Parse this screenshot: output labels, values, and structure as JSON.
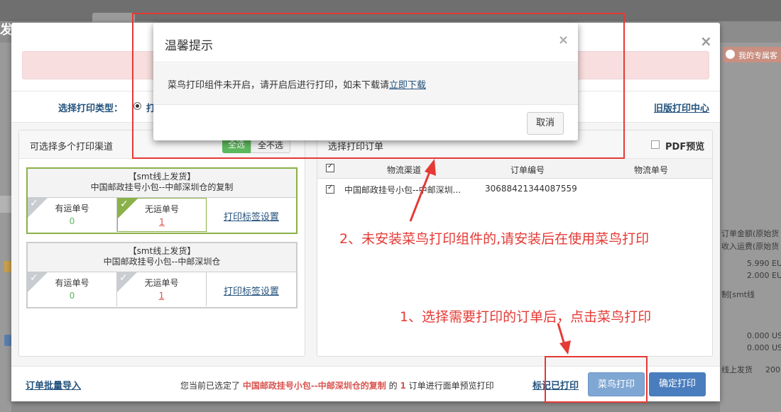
{
  "background": {
    "left_text": "发",
    "service_label": "我的专属客",
    "right_texts": [
      "订单金额(原始货",
      "收入运费(原始货",
      "5.990 EU",
      "2.000 EU",
      "制[smt线",
      "0.000 US",
      "0.000 US",
      "线上发货",
      "200"
    ]
  },
  "dialog": {
    "print_type_label": "选择打印类型：",
    "print_type_option": "打",
    "old_print_center": "旧版打印中心",
    "left_panel": {
      "title": "可选择多个打印渠道",
      "select_all": "全选",
      "select_none": "全不选",
      "cards": [
        {
          "title_line1": "【smt线上发货】",
          "title_line2": "中国邮政挂号小包--中邮深圳仓的复制",
          "with_tracking_label": "有运单号",
          "with_tracking_count": "0",
          "without_tracking_label": "无运单号",
          "without_tracking_count": "1",
          "label_settings": "打印标签设置"
        },
        {
          "title_line1": "【smt线上发货】",
          "title_line2": "中国邮政挂号小包--中邮深圳仓",
          "with_tracking_label": "有运单号",
          "with_tracking_count": "0",
          "without_tracking_label": "无运单号",
          "without_tracking_count": "1",
          "label_settings": "打印标签设置"
        }
      ]
    },
    "right_panel": {
      "title": "选择打印订单",
      "pdf_preview": "PDF预览",
      "columns": [
        "物流渠道",
        "订单编号",
        "物流单号"
      ],
      "rows": [
        {
          "channel": "中国邮政挂号小包--中邮深圳...",
          "order_no": "30688421344087559",
          "tracking_no": ""
        }
      ]
    },
    "footer": {
      "batch_import": "订单批量导入",
      "msg_prefix": "您当前已选定了",
      "msg_channel": "中国邮政挂号小包--中邮深圳仓的复制",
      "msg_mid": "的",
      "msg_count": "1",
      "msg_suffix": "订单进行面单预览打印",
      "mark_printed": "标记已打印",
      "cainiao_print": "菜鸟打印",
      "confirm_print": "确定打印"
    }
  },
  "tip": {
    "title": "温馨提示",
    "message": "菜鸟打印组件未开启，请开启后进行打印，如未下载请",
    "download_link": "立即下载",
    "cancel": "取消"
  },
  "annotations": {
    "note2": "2、未安装菜鸟打印组件的,请安装后在使用菜鸟打印",
    "note1": "1、选择需要打印的订单后，点击菜鸟打印"
  },
  "colors": {
    "annotation_red": "#e53935",
    "accent_blue": "#4a7dbd",
    "green": "#5cb85c"
  },
  "icons": {
    "close": "close-icon",
    "check": "checkmark-icon",
    "radio": "radio-icon",
    "user": "user-icon"
  }
}
